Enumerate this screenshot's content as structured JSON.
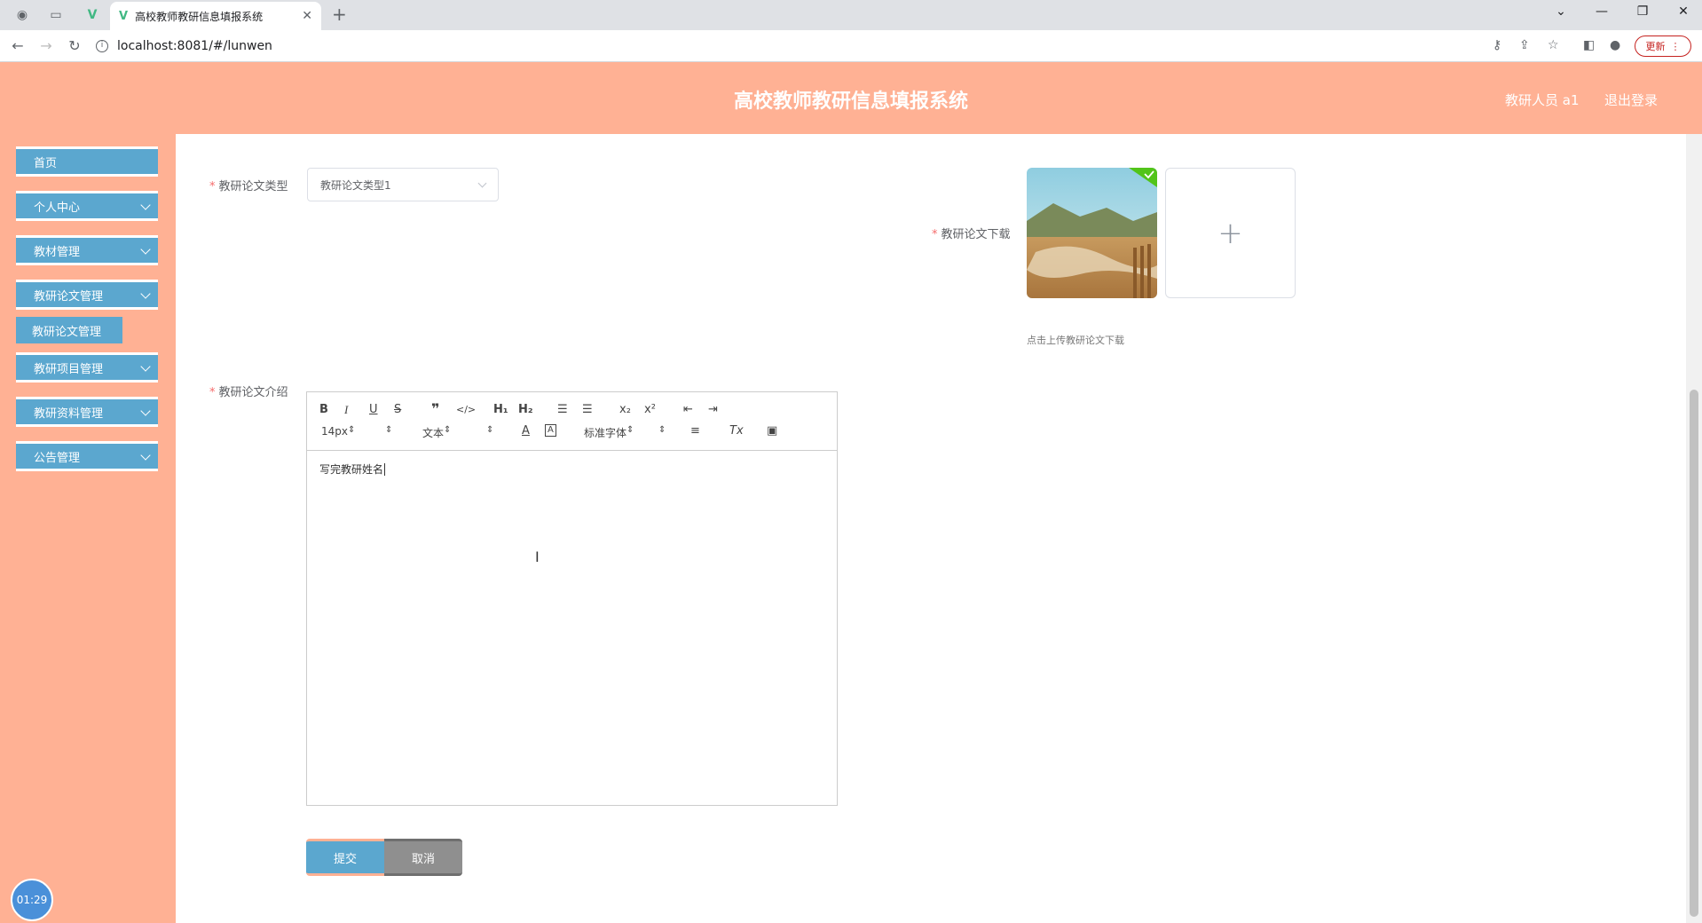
{
  "browser": {
    "tab_title": "高校教师教研信息填报系统",
    "url": "localhost:8081/#/lunwen",
    "update_label": "更新"
  },
  "header": {
    "title": "高校教师教研信息填报系统",
    "user_label": "教研人员 a1",
    "logout_label": "退出登录"
  },
  "sidebar": {
    "items": [
      {
        "label": "首页"
      },
      {
        "label": "个人中心"
      },
      {
        "label": "教材管理"
      },
      {
        "label": "教研论文管理"
      },
      {
        "label": "教研项目管理"
      },
      {
        "label": "教研资料管理"
      },
      {
        "label": "公告管理"
      }
    ],
    "active_sub": "教研论文管理",
    "timer": "01:29"
  },
  "form": {
    "type_label": "教研论文类型",
    "type_value": "教研论文类型1",
    "download_label": "教研论文下载",
    "upload_tip": "点击上传教研论文下载",
    "intro_label": "教研论文介绍",
    "editor": {
      "font_size": "14px",
      "block_type": "文本",
      "font_family": "标准字体",
      "content": "写完教研姓名"
    },
    "submit_label": "提交",
    "cancel_label": "取消"
  },
  "colors": {
    "header_bg": "#ffb194",
    "menu_bg": "#5ba7cf",
    "cancel_bg": "#8f8f8f"
  }
}
